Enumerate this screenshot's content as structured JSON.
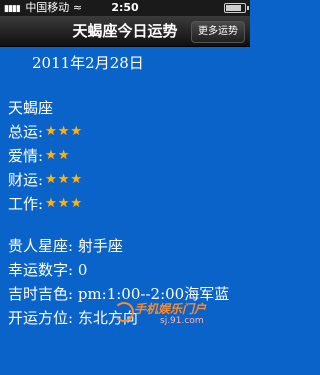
{
  "status_bar": {
    "carrier": "中国移动",
    "signal": "▮▮▮▮",
    "wifi": "≈",
    "time": "2:50"
  },
  "navbar": {
    "title": "天蝎座今日运势",
    "more_button": "更多运势"
  },
  "content": {
    "date": "2011年2月28日",
    "sign": "天蝎座",
    "ratings": [
      {
        "label": "总运:",
        "stars": "★★★"
      },
      {
        "label": "爱情:",
        "stars": "★★"
      },
      {
        "label": "财运:",
        "stars": "★★★"
      },
      {
        "label": "工作:",
        "stars": "★★★"
      }
    ],
    "details": [
      "贵人星座: 射手座",
      "幸运数字: 0",
      "吉时吉色: pm:1:00--2:00海军蓝",
      "开运方位: 东北方向"
    ]
  },
  "watermark": {
    "logo": "手机娱乐门户",
    "site": "sj.91.com"
  },
  "colors": {
    "background": "#0a63c9",
    "star": "#f7b417"
  }
}
